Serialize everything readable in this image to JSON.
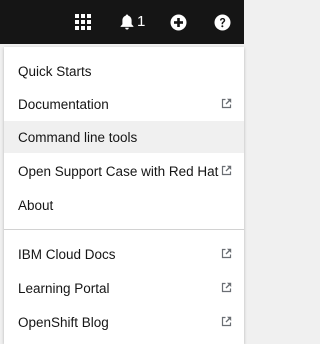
{
  "masthead": {
    "icons": [
      "app-launcher-icon",
      "bell-icon",
      "plus-circle-icon",
      "question-circle-icon"
    ],
    "notification_count": "1",
    "background": "#151515"
  },
  "help_menu": {
    "group1": [
      {
        "label": "Quick Starts",
        "external": false
      },
      {
        "label": "Documentation",
        "external": true
      },
      {
        "label": "Command line tools",
        "external": false,
        "highlighted": true
      },
      {
        "label": "Open Support Case with Red Hat",
        "external": true
      },
      {
        "label": "About",
        "external": false
      }
    ],
    "group2": [
      {
        "label": "IBM Cloud Docs",
        "external": true
      },
      {
        "label": "Learning Portal",
        "external": true
      },
      {
        "label": "OpenShift Blog",
        "external": true
      }
    ]
  }
}
